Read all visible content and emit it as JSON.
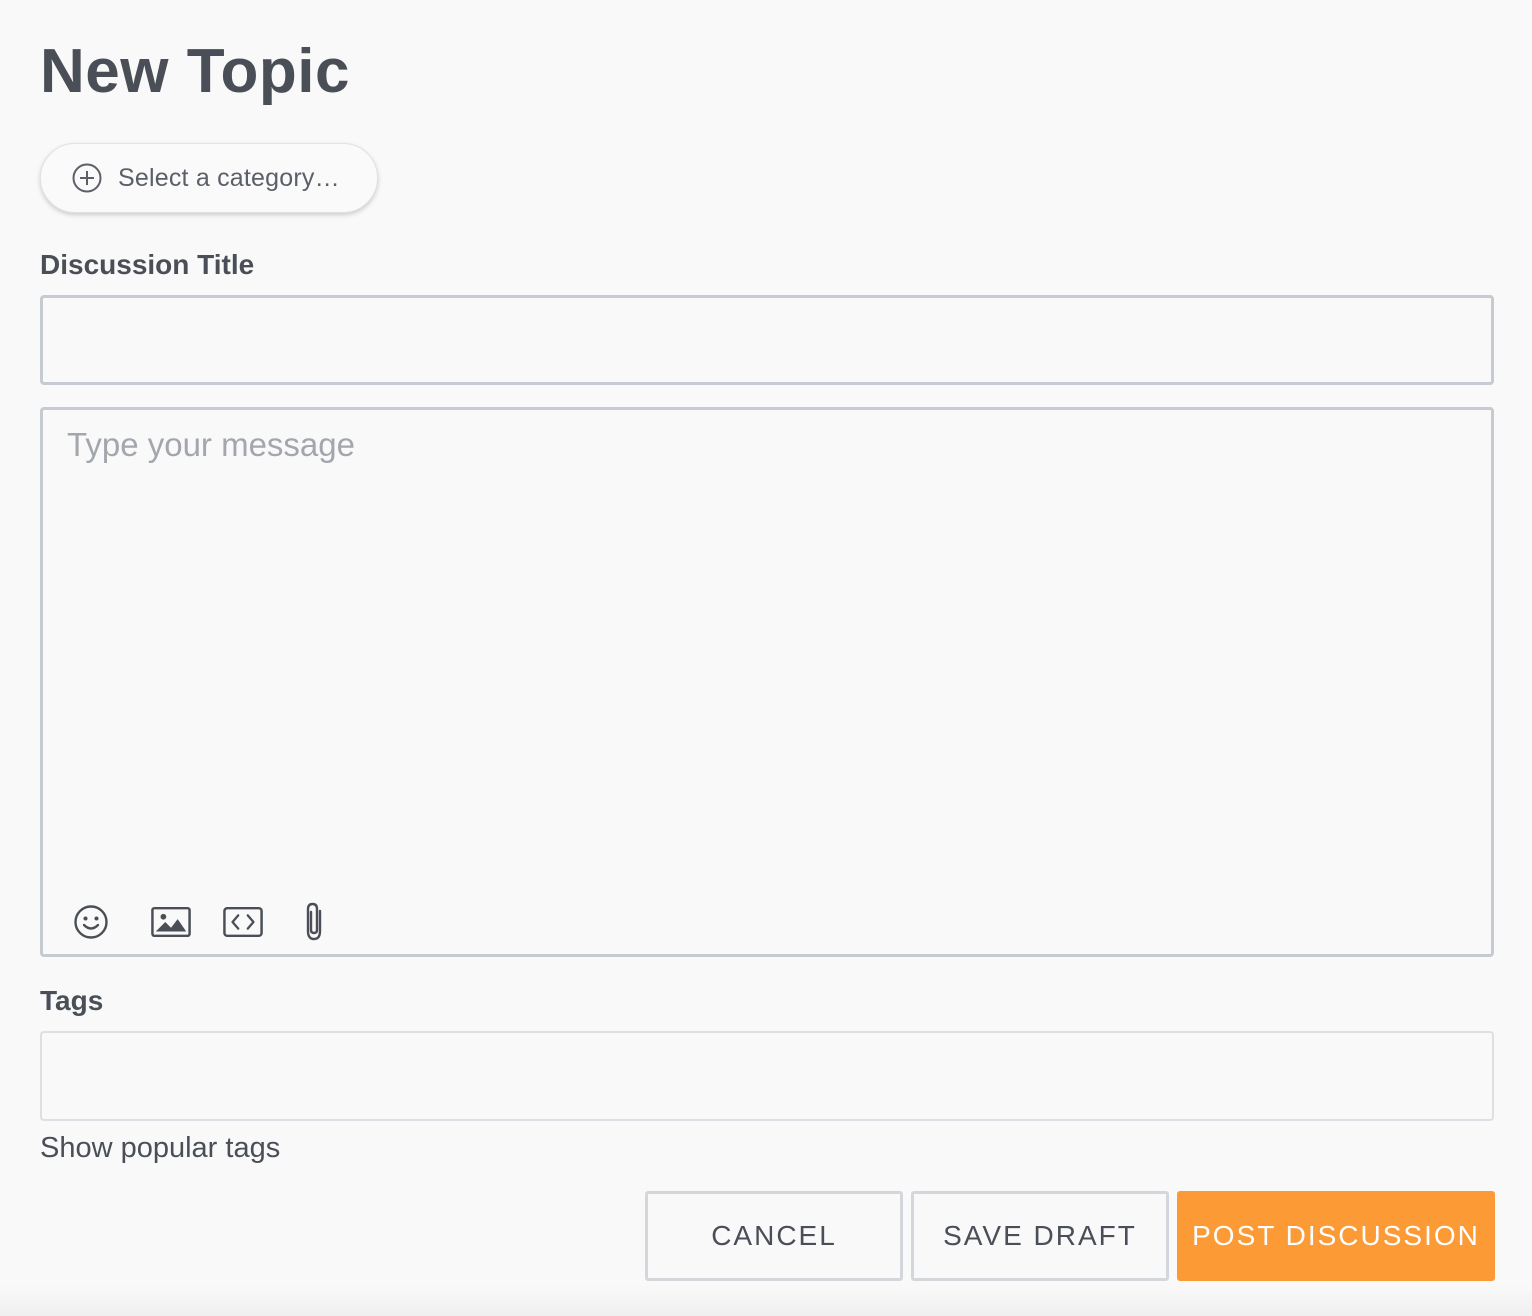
{
  "page": {
    "title": "New Topic"
  },
  "category": {
    "placeholder_label": "Select a category…",
    "icon": "plus-circle-icon"
  },
  "discussion_title": {
    "label": "Discussion Title",
    "value": "",
    "placeholder": ""
  },
  "message": {
    "value": "",
    "placeholder": "Type your message",
    "toolbar": [
      {
        "name": "emoji-icon",
        "glyph": "smiley"
      },
      {
        "name": "image-icon",
        "glyph": "picture"
      },
      {
        "name": "code-icon",
        "glyph": "code-brackets"
      },
      {
        "name": "attachment-icon",
        "glyph": "paperclip"
      }
    ]
  },
  "tags": {
    "label": "Tags",
    "value": "",
    "placeholder": "",
    "show_popular_label": "Show popular tags"
  },
  "actions": {
    "cancel_label": "CANCEL",
    "save_draft_label": "SAVE DRAFT",
    "post_label": "POST DISCUSSION"
  },
  "colors": {
    "background": "#f9f9f9",
    "text": "#4a4f57",
    "input_border": "#c6cbd2",
    "accent": "#fc9a36",
    "accent_text": "#ffffff"
  }
}
